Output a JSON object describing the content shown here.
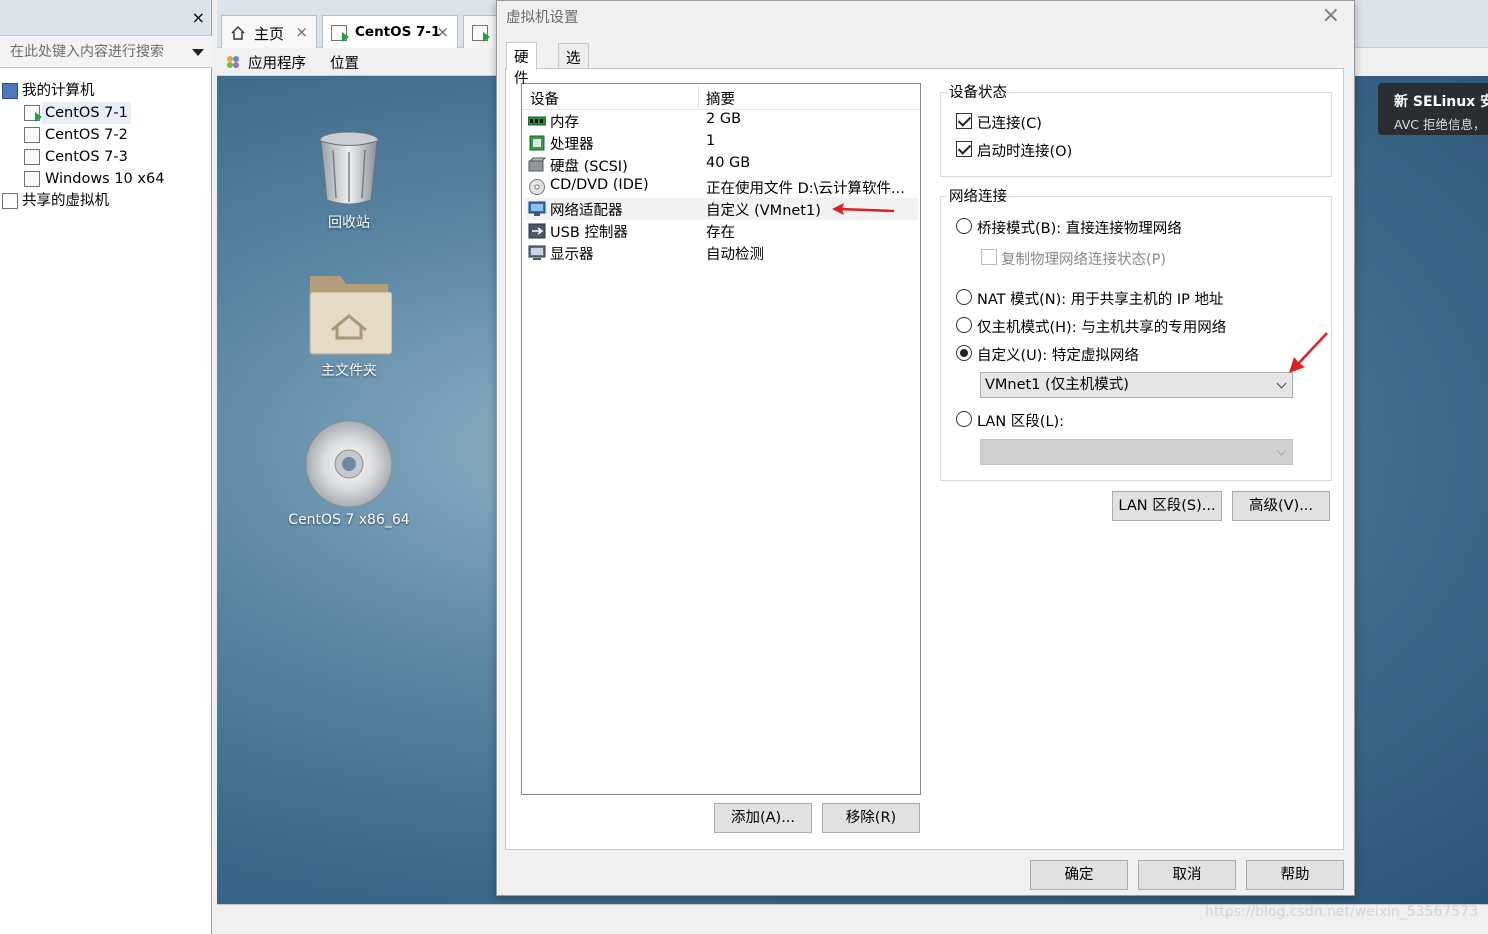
{
  "library": {
    "close_symbol": "×",
    "search_placeholder": "在此处键入内容进行搜索",
    "tree": [
      {
        "label": "我的计算机",
        "icon": "computer-icon"
      },
      {
        "label": "CentOS 7-1",
        "icon": "vm-running-icon",
        "selected": true
      },
      {
        "label": "CentOS 7-2",
        "icon": "vm-icon"
      },
      {
        "label": "CentOS 7-3",
        "icon": "vm-icon"
      },
      {
        "label": "Windows 10 x64",
        "icon": "vm-icon"
      },
      {
        "label": "共享的虚拟机",
        "icon": "shared-vm-icon"
      }
    ]
  },
  "guest": {
    "tabs": [
      {
        "label": "主页",
        "close": "×"
      },
      {
        "label": "CentOS 7-1",
        "close": "×"
      }
    ],
    "menu": {
      "apps": "应用程序",
      "places": "位置"
    },
    "desktop_icons": {
      "trash": "回收站",
      "home": "主文件夹",
      "disc": "CentOS 7 x86_64"
    },
    "notification": {
      "title": "新 SELinux 安",
      "body": "AVC 拒绝信息，"
    },
    "watermark": "https://blog.csdn.net/weixin_53567573"
  },
  "dialog": {
    "title": "虚拟机设置",
    "close_symbol": "×",
    "tabs": {
      "hardware": "硬件",
      "options": "选项"
    },
    "device_table": {
      "col_device": "设备",
      "col_summary": "摘要",
      "rows": [
        {
          "name": "内存",
          "summary": "2 GB"
        },
        {
          "name": "处理器",
          "summary": "1"
        },
        {
          "name": "硬盘 (SCSI)",
          "summary": "40 GB"
        },
        {
          "name": "CD/DVD (IDE)",
          "summary": "正在使用文件 D:\\云计算软件..."
        },
        {
          "name": "网络适配器",
          "summary": "自定义 (VMnet1)"
        },
        {
          "name": "USB 控制器",
          "summary": "存在"
        },
        {
          "name": "显示器",
          "summary": "自动检测"
        }
      ]
    },
    "buttons": {
      "add": "添加(A)...",
      "remove": "移除(R)",
      "ok": "确定",
      "cancel": "取消",
      "help": "帮助",
      "lan_segments": "LAN 区段(S)...",
      "advanced": "高级(V)..."
    },
    "device_status": {
      "title": "设备状态",
      "connected": "已连接(C)",
      "connect_on_power": "启动时连接(O)"
    },
    "network": {
      "title": "网络连接",
      "bridged": "桥接模式(B): 直接连接物理网络",
      "replicate": "复制物理网络连接状态(P)",
      "nat": "NAT 模式(N): 用于共享主机的 IP 地址",
      "host_only": "仅主机模式(H): 与主机共享的专用网络",
      "custom": "自定义(U): 特定虚拟网络",
      "custom_value": "VMnet1 (仅主机模式)",
      "lan_segment": "LAN 区段(L):",
      "lan_value": ""
    },
    "colors": {
      "annotation_arrow": "#e02020"
    }
  }
}
